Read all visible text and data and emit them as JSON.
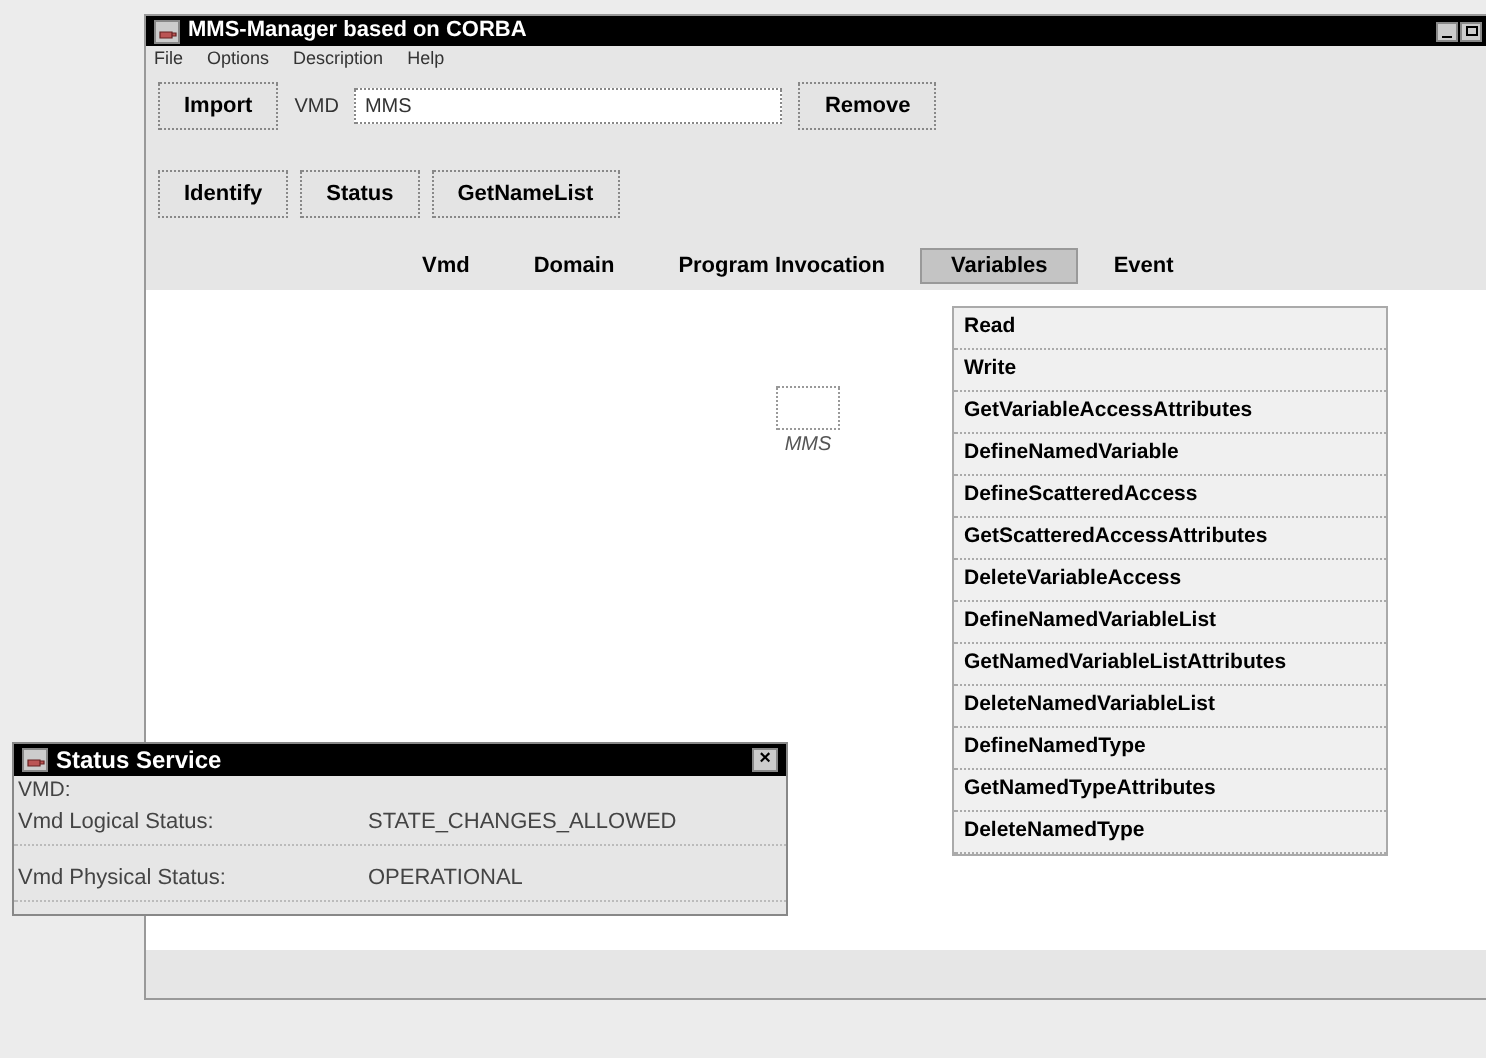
{
  "window": {
    "title": "MMS-Manager based on CORBA"
  },
  "menu": [
    "File",
    "Options",
    "Description",
    "Help"
  ],
  "toolbar": {
    "import_button": "Import",
    "vmd_label": "VMD",
    "vmd_field": {
      "value": "MMS"
    },
    "remove_button": "Remove"
  },
  "actions": [
    "Identify",
    "Status",
    "GetNameList"
  ],
  "tabs": [
    {
      "label": "Vmd",
      "selected": false
    },
    {
      "label": "Domain",
      "selected": false
    },
    {
      "label": "Program Invocation",
      "selected": false
    },
    {
      "label": "Variables",
      "selected": true
    },
    {
      "label": "Event",
      "selected": false
    }
  ],
  "dropdown": [
    "Read",
    "Write",
    "GetVariableAccessAttributes",
    "DefineNamedVariable",
    "DefineScatteredAccess",
    "GetScatteredAccessAttributes",
    "DeleteVariableAccess",
    "DefineNamedVariableList",
    "GetNamedVariableListAttributes",
    "DeleteNamedVariableList",
    "DefineNamedType",
    "GetNamedTypeAttributes",
    "DeleteNamedType"
  ],
  "canvas": {
    "node_label": "MMS"
  },
  "status_dialog": {
    "title": "Status Service",
    "close": "×",
    "section": "VMD:",
    "rows": [
      {
        "label": "Vmd Logical Status:",
        "value": "STATE_CHANGES_ALLOWED"
      },
      {
        "label": "Vmd Physical Status:",
        "value": "OPERATIONAL"
      }
    ]
  }
}
